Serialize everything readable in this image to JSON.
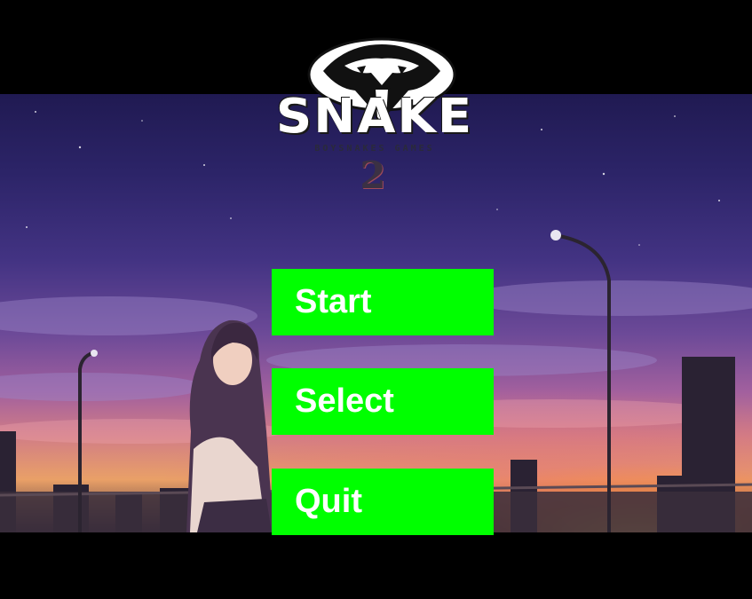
{
  "game": {
    "logo": {
      "title": "SNAKE",
      "subtitle": "BOYSNAKES GAMES",
      "number": "2",
      "emblem_icon": "cobra-head-icon"
    }
  },
  "menu": {
    "items": [
      {
        "label": "Start"
      },
      {
        "label": "Select"
      },
      {
        "label": "Quit"
      }
    ],
    "button_color": "#00ff00",
    "label_color": "#ffffff"
  },
  "background": {
    "sky_top": "#201a52",
    "sky_mid": "#6d4a98",
    "horizon_glow": "#ffc450",
    "letterbox": "#000000"
  }
}
